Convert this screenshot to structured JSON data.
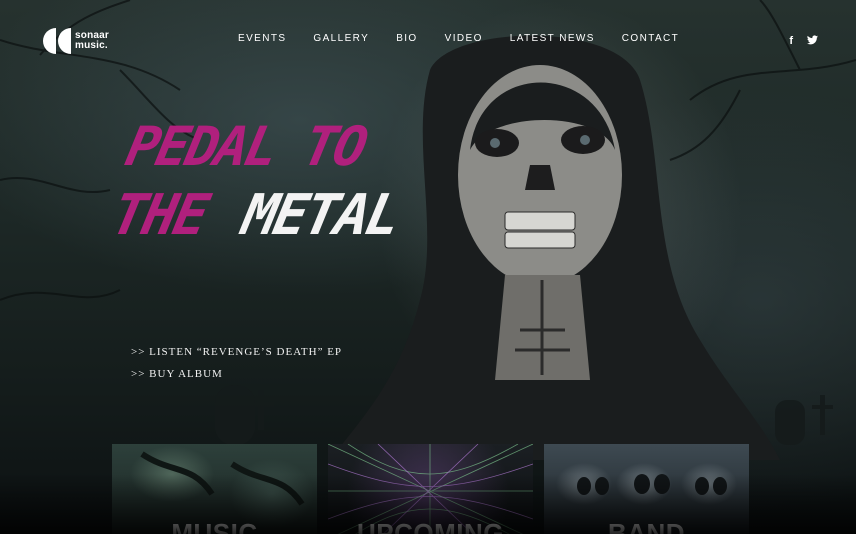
{
  "brand": {
    "logo_text_line1": "sonaar",
    "logo_text_line2": "music."
  },
  "nav": {
    "items": [
      {
        "label": "EVENTS"
      },
      {
        "label": "GALLERY"
      },
      {
        "label": "BIO"
      },
      {
        "label": "VIDEO"
      },
      {
        "label": "LATEST NEWS"
      },
      {
        "label": "CONTACT"
      }
    ]
  },
  "social": {
    "facebook": "f",
    "twitter": "t"
  },
  "hero": {
    "headline_line1": "PEDAL TO",
    "headline_the": "THE",
    "headline_metal": "METAL",
    "links": [
      {
        "label": ">> LISTEN “REVENGE’S DEATH” EP"
      },
      {
        "label": ">> BUY ALBUM"
      }
    ]
  },
  "cards": [
    {
      "label": "MUSIC"
    },
    {
      "label": "UPCOMING"
    },
    {
      "label": "BAND"
    }
  ],
  "colors": {
    "accent": "#b0207d",
    "text": "#ffffff"
  }
}
